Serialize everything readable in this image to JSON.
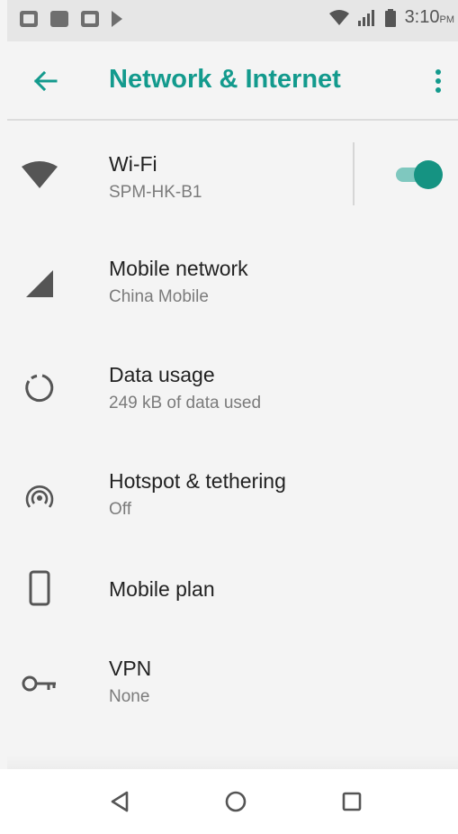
{
  "status_bar": {
    "time": "3:10",
    "time_suffix": "PM"
  },
  "app_bar": {
    "title": "Network & Internet"
  },
  "items": [
    {
      "title": "Wi-Fi",
      "subtitle": "SPM-HK-B1",
      "toggle_on": true
    },
    {
      "title": "Mobile network",
      "subtitle": "China Mobile"
    },
    {
      "title": "Data usage",
      "subtitle": "249 kB of data used"
    },
    {
      "title": "Hotspot & tethering",
      "subtitle": "Off"
    },
    {
      "title": "Mobile plan"
    },
    {
      "title": "VPN",
      "subtitle": "None"
    }
  ],
  "colors": {
    "accent": "#139a8d",
    "toggle_thumb": "#159382",
    "toggle_track": "#7fc8bf"
  }
}
